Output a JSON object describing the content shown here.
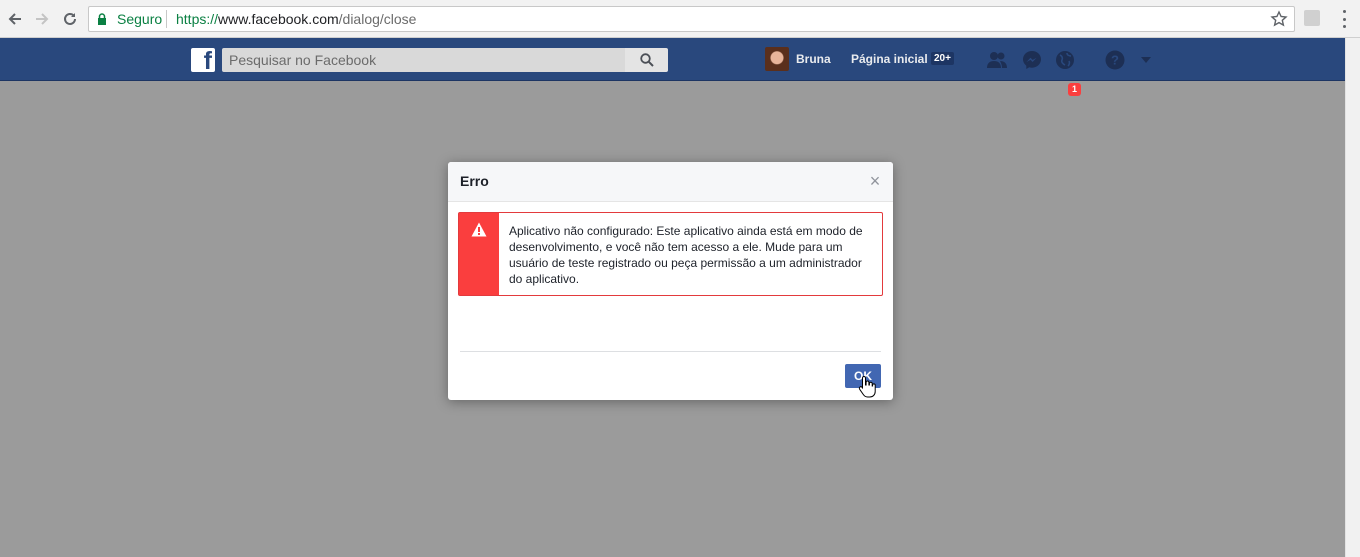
{
  "browser": {
    "secure_label": "Seguro",
    "url_scheme": "https://",
    "url_host": "www.facebook.com",
    "url_path": "/dialog/close"
  },
  "facebook": {
    "search_placeholder": "Pesquisar no Facebook",
    "profile_name": "Bruna",
    "home_label": "Página inicial",
    "home_badge": "20+",
    "notification_count": "1",
    "brand_color": "#29487d"
  },
  "dialog": {
    "title": "Erro",
    "close_glyph": "×",
    "error_message": "Aplicativo não configurado: Este aplicativo ainda está em modo de desenvolvimento, e você não tem acesso a ele. Mude para um usuário de teste registrado ou peça permissão a um administrador do aplicativo.",
    "ok_label": "OK",
    "error_color": "#fa3e3e",
    "button_color": "#4267b2"
  },
  "icons": {
    "back": "back-arrow-icon",
    "forward": "forward-arrow-icon",
    "reload": "reload-icon",
    "lock": "lock-icon",
    "star": "bookmark-star-icon",
    "search": "search-icon",
    "friends": "friend-requests-icon",
    "messenger": "messenger-icon",
    "notifications": "globe-notifications-icon",
    "help": "help-icon",
    "account": "account-menu-chevron-icon",
    "warning": "warning-icon",
    "cursor": "hand-pointer-icon"
  }
}
